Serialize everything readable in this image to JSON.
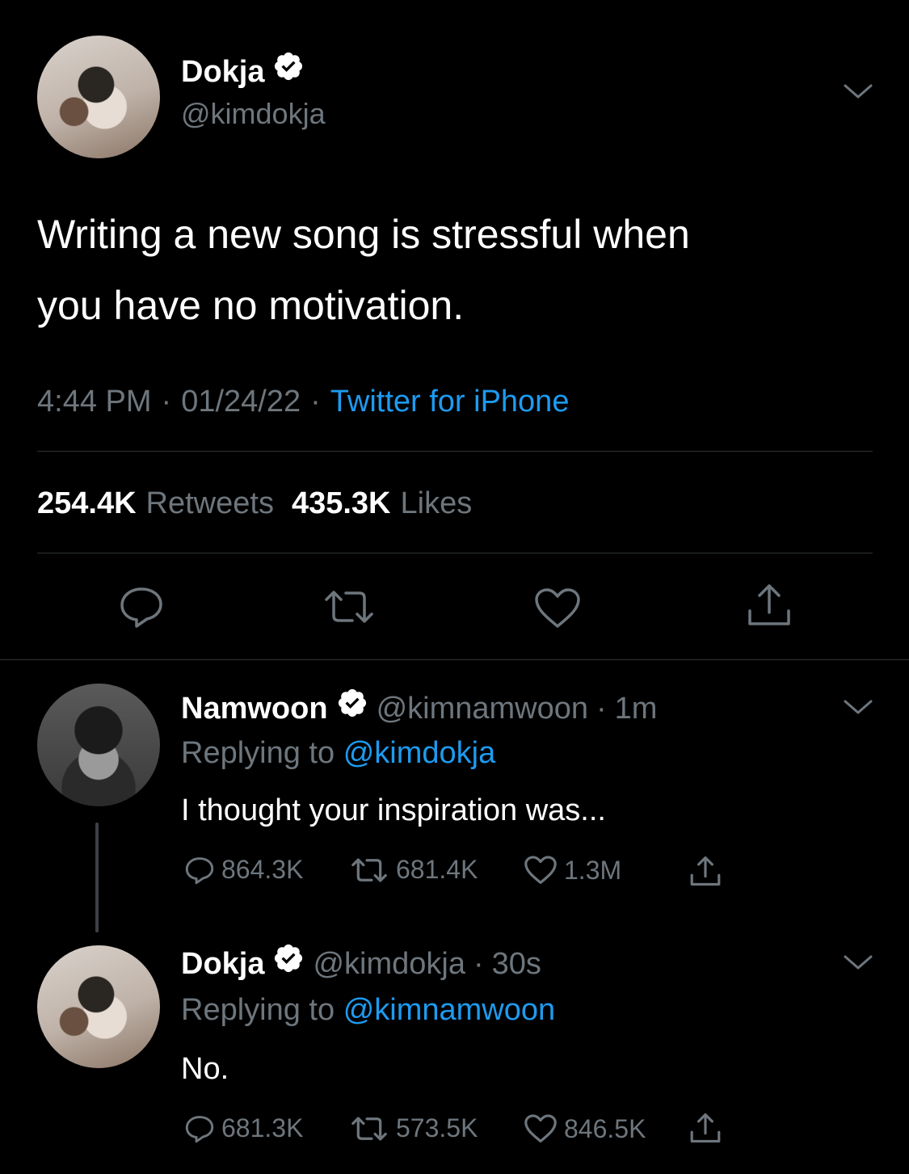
{
  "main_tweet": {
    "author": {
      "name": "Dokja",
      "handle": "@kimdokja"
    },
    "text_line1": "Writing a new song is stressful when",
    "text_line2": "you have no motivation.",
    "time": "4:44 PM",
    "separator": "·",
    "date": "01/24/22",
    "source": "Twitter for iPhone",
    "retweets_count": "254.4K",
    "retweets_label": "Retweets",
    "likes_count": "435.3K",
    "likes_label": "Likes"
  },
  "replies": [
    {
      "name": "Namwoon",
      "handle": "@kimnamwoon",
      "separator": "·",
      "time": "1m",
      "replying_prefix": "Replying to",
      "replying_to": "@kimdokja",
      "text": "I thought your inspiration was...",
      "replies": "864.3K",
      "retweets": "681.4K",
      "likes": "1.3M"
    },
    {
      "name": "Dokja",
      "handle": "@kimdokja",
      "separator": "·",
      "time": "30s",
      "replying_prefix": "Replying to",
      "replying_to": "@kimnamwoon",
      "text": "No.",
      "replies": "681.3K",
      "retweets": "573.5K",
      "likes": "846.5K"
    }
  ],
  "colors": {
    "background": "#000000",
    "link": "#1d9bf0",
    "muted": "#6e767d",
    "divider": "#2f3336"
  },
  "icons": [
    "verified-badge-icon",
    "chevron-down-icon",
    "reply-icon",
    "retweet-icon",
    "like-icon",
    "share-icon"
  ]
}
